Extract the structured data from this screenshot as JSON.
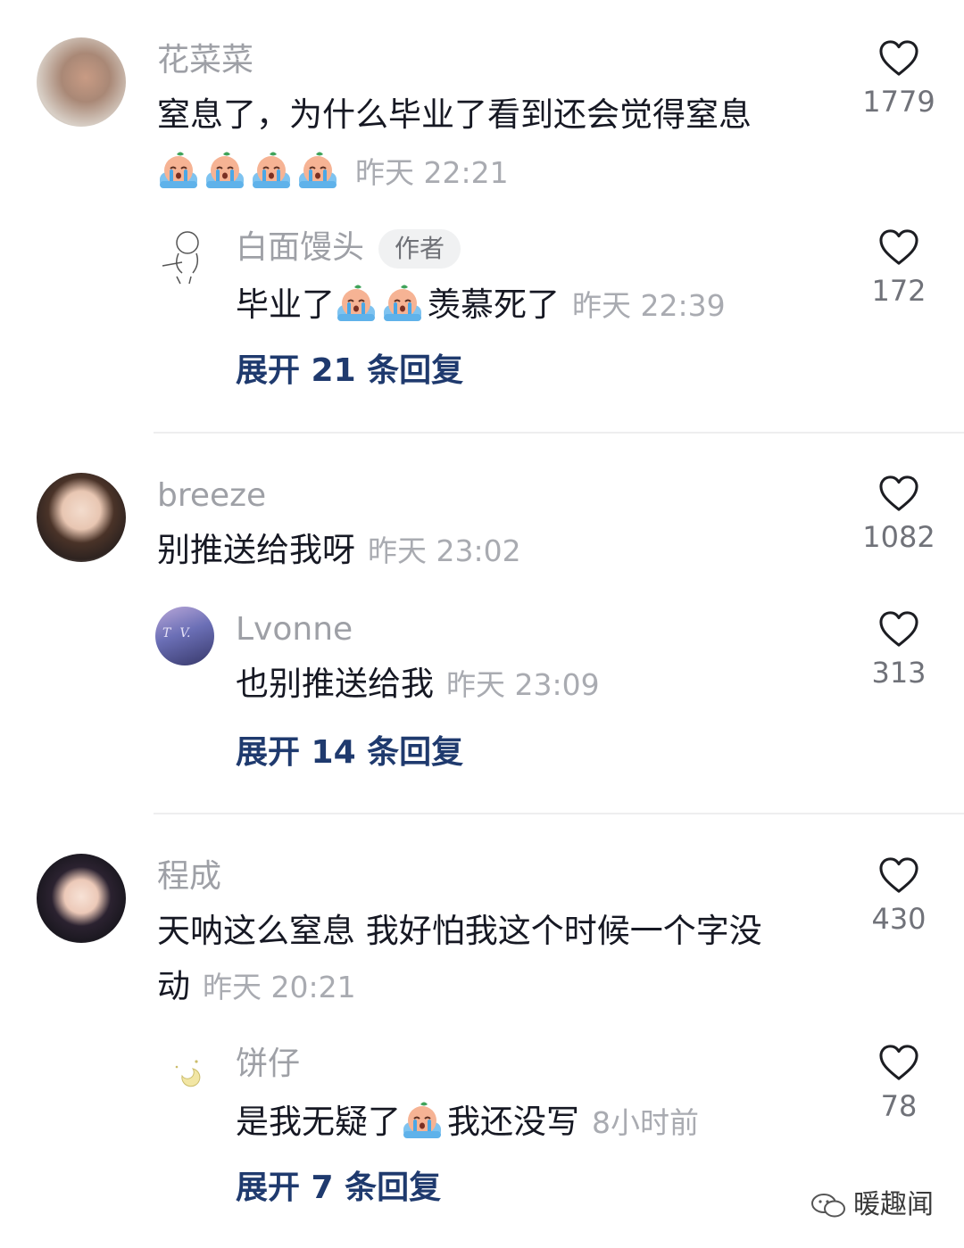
{
  "comments": [
    {
      "user": "花菜菜",
      "text": "窒息了，为什么毕业了看到还会觉得窒息",
      "time": "昨天 22:21",
      "likes": "1779",
      "reply": {
        "user": "白面馒头",
        "badge": "作者",
        "text_a": "毕业了",
        "text_b": "羡慕死了",
        "time": "昨天 22:39",
        "likes": "172"
      },
      "expand": "展开 21 条回复"
    },
    {
      "user": "breeze",
      "text": "别推送给我呀",
      "time": "昨天 23:02",
      "likes": "1082",
      "reply": {
        "user": "Lvonne",
        "text": "也别推送给我",
        "time": "昨天 23:09",
        "likes": "313"
      },
      "expand": "展开 14 条回复"
    },
    {
      "user": "程成",
      "text_line1": "天呐这么窒息 我好怕我这个时候一个字没",
      "text_line2": "动",
      "time": "昨天 20:21",
      "likes": "430",
      "reply": {
        "user": "饼仔",
        "text_a": "是我无疑了",
        "text_b": "我还没写",
        "time": "8小时前",
        "likes": "78"
      },
      "expand": "展开 7 条回复"
    }
  ],
  "watermark": "暖趣闻",
  "icons": {
    "like": "heart-outline-icon",
    "emoji": "crying-peach-emoji-icon"
  },
  "colors": {
    "link": "#1f3a6e",
    "muted": "#9ea0a6",
    "text": "#161823"
  }
}
